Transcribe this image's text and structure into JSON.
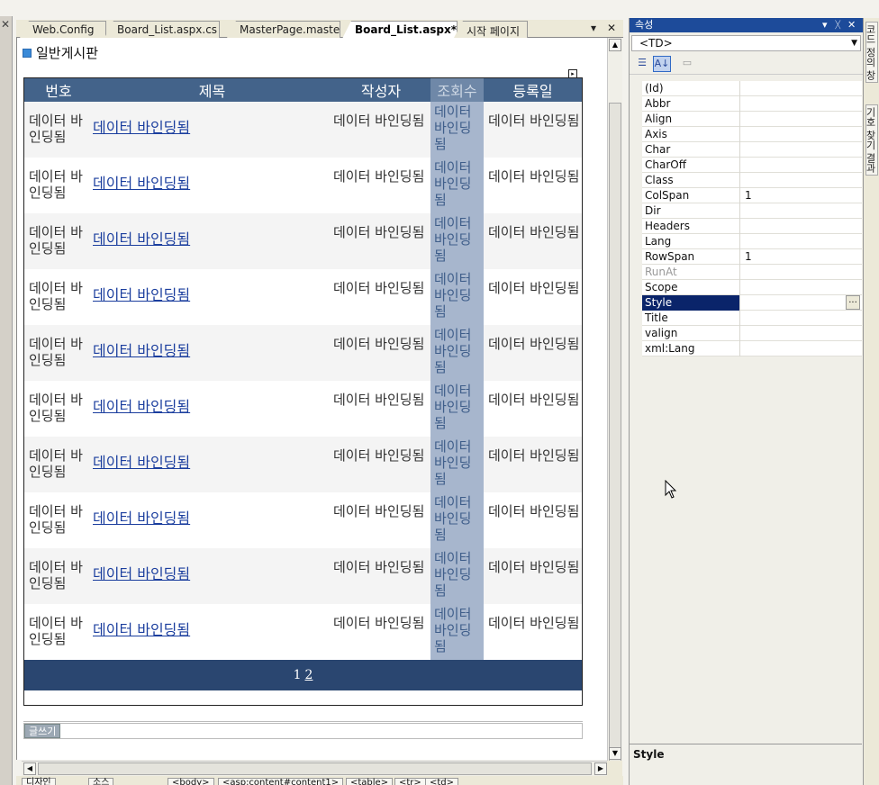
{
  "tabs": [
    {
      "label": "Web.Config",
      "active": false
    },
    {
      "label": "Board_List.aspx.cs",
      "active": false
    },
    {
      "label": "MasterPage.master",
      "active": false
    },
    {
      "label": "Board_List.aspx*",
      "active": true
    },
    {
      "label": "시작 페이지",
      "active": false
    }
  ],
  "tab_controls": {
    "dropdown": "▾",
    "close": "✕"
  },
  "design": {
    "page_title": "일반게시판",
    "smart_tag": "▸",
    "columns": [
      "번호",
      "제목",
      "작성자",
      "조회수",
      "등록일"
    ],
    "bound_text": "데이터 바인딩됨",
    "row_count": 10,
    "pager": {
      "current": "1",
      "next": "2"
    },
    "write_button": "글쓰기"
  },
  "tagbar": [
    "디자인",
    "소스",
    "<body>",
    "<asp:content#content1>",
    "<table>",
    "<tr>",
    "<td>"
  ],
  "properties": {
    "title": "속성",
    "title_controls": [
      "▾",
      "ᚷ",
      "✕"
    ],
    "object": "<TD>",
    "rows": [
      {
        "name": "(Id)",
        "value": ""
      },
      {
        "name": "Abbr",
        "value": ""
      },
      {
        "name": "Align",
        "value": ""
      },
      {
        "name": "Axis",
        "value": ""
      },
      {
        "name": "Char",
        "value": ""
      },
      {
        "name": "CharOff",
        "value": ""
      },
      {
        "name": "Class",
        "value": ""
      },
      {
        "name": "ColSpan",
        "value": "1"
      },
      {
        "name": "Dir",
        "value": ""
      },
      {
        "name": "Headers",
        "value": ""
      },
      {
        "name": "Lang",
        "value": ""
      },
      {
        "name": "RowSpan",
        "value": "1"
      },
      {
        "name": "RunAt",
        "value": ""
      },
      {
        "name": "Scope",
        "value": ""
      },
      {
        "name": "Style",
        "value": ""
      },
      {
        "name": "Title",
        "value": ""
      },
      {
        "name": "valign",
        "value": ""
      },
      {
        "name": "xml:Lang",
        "value": ""
      }
    ],
    "disabled_row": "RunAt",
    "selected_row": "Style",
    "ellipsis": "...",
    "description_title": "Style"
  },
  "side_tabs": [
    "코드 정의 창",
    "기호 찾기 결과"
  ],
  "colors": {
    "header": "#43638a",
    "highlight_col": "#a7b6cd",
    "pager": "#2a4670",
    "selection": "#0a246a",
    "panel_title": "#1d4b9a"
  }
}
